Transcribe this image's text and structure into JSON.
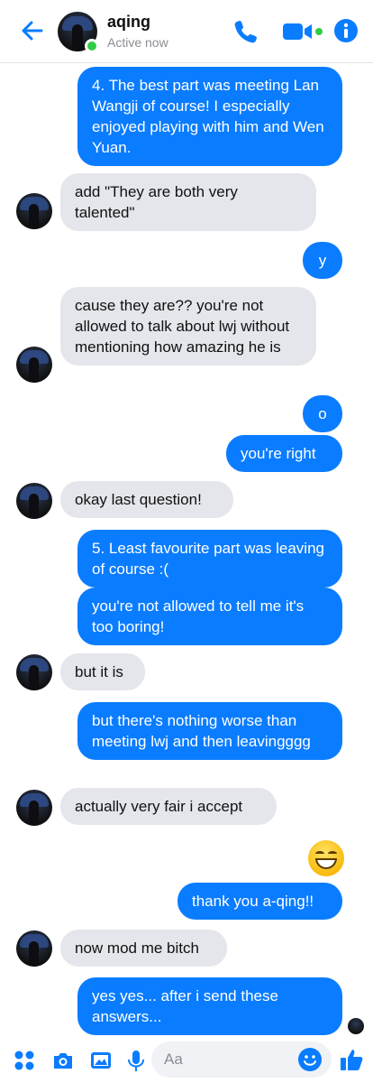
{
  "header": {
    "contact_name": "aqing",
    "status": "Active now",
    "icons": [
      "back-arrow-icon",
      "phone-icon",
      "video-camera-icon",
      "info-icon"
    ]
  },
  "colors": {
    "accent": "#0a7cff",
    "incoming_bubble": "#e4e6eb",
    "online": "#31cc46"
  },
  "messages": [
    {
      "sender": "me",
      "text": "4. The best part was meeting Lan Wangji of course! I especially enjoyed playing with him and Wen Yuan."
    },
    {
      "sender": "aqing",
      "text": "add \"They are both very talented\""
    },
    {
      "sender": "me",
      "text": "y"
    },
    {
      "sender": "aqing",
      "text": "cause they are?? you're not allowed to talk about lwj without mentioning how amazing he is"
    },
    {
      "sender": "me",
      "text": "o"
    },
    {
      "sender": "me",
      "text": "you're right"
    },
    {
      "sender": "aqing",
      "text": "okay last question!"
    },
    {
      "sender": "me",
      "text": "5. Least favourite part was leaving of course :("
    },
    {
      "sender": "me",
      "text": "you're not allowed to tell me it's too boring!"
    },
    {
      "sender": "aqing",
      "text": "but it is"
    },
    {
      "sender": "me",
      "text": "but there's nothing worse than meeting lwj and then leavingggg"
    },
    {
      "sender": "aqing",
      "text": "actually very fair i accept"
    },
    {
      "sender": "me",
      "emoji": "grinning-face-emoji"
    },
    {
      "sender": "me",
      "text": "thank you a-qing!!"
    },
    {
      "sender": "aqing",
      "text": "now mod me bitch"
    },
    {
      "sender": "me",
      "text": "yes yes... after i send these answers..."
    }
  ],
  "composer": {
    "placeholder": "Aa",
    "value": "",
    "icons": [
      "apps-grid-icon",
      "camera-icon",
      "image-icon",
      "microphone-icon",
      "emoji-icon",
      "thumbs-up-icon"
    ]
  }
}
